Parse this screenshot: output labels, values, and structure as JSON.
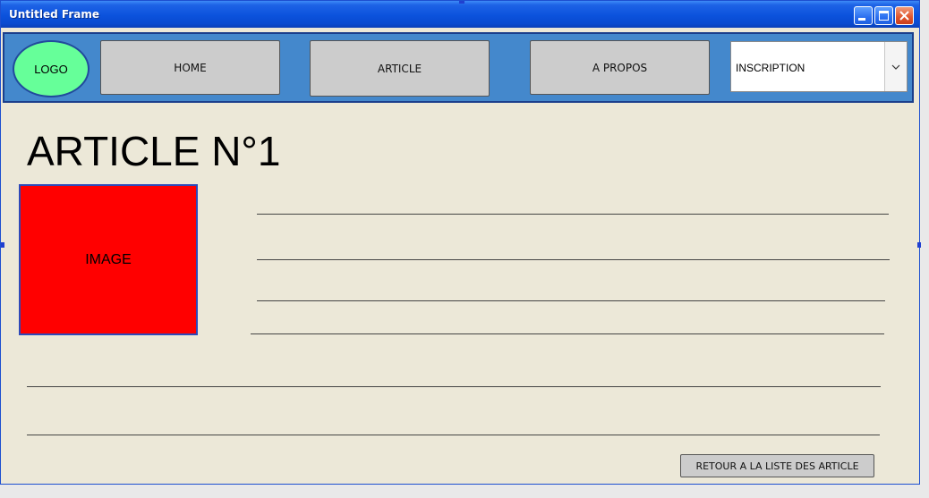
{
  "window": {
    "title": "Untitled Frame",
    "controls": {
      "minimize_icon": "minimize-icon",
      "maximize_icon": "maximize-icon",
      "close_icon": "close-icon"
    }
  },
  "navbar": {
    "logo_label": "LOGO",
    "items": [
      {
        "label": "HOME"
      },
      {
        "label": "ARTICLE"
      },
      {
        "label": "A PROPOS"
      }
    ],
    "inscription": {
      "selected": "INSCRIPTION",
      "arrow_icon": "chevron-down-icon"
    }
  },
  "main": {
    "title": "ARTICLE N°1",
    "image_label": "IMAGE",
    "back_button_label": "RETOUR A LA LISTE DES ARTICLE"
  },
  "colors": {
    "titlebar": "#0b52dc",
    "navbar_bg": "#4488cc",
    "logo_bg": "#66ff99",
    "image_bg": "#ff0000",
    "button_bg": "#cccccc",
    "content_bg": "#ece8d8"
  }
}
